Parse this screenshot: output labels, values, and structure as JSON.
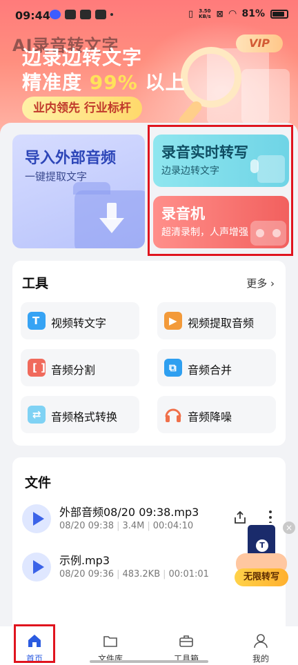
{
  "status_bar": {
    "time": "09:44",
    "net_speed_value": "3.50",
    "net_speed_unit": "KB/s",
    "battery": "81%"
  },
  "header": {
    "app_title": "AI录音转文字",
    "slogan_line1": "边录边转文字",
    "slogan_line2_prefix": "精准度",
    "slogan_line2_highlight": "99%",
    "slogan_line2_suffix": "以上",
    "badge": "业内领先 行业标杆",
    "vip_label": "VIP"
  },
  "feature_cards": {
    "import": {
      "title": "导入外部音频",
      "subtitle": "一键提取文字"
    },
    "realtime": {
      "title": "录音实时转写",
      "subtitle": "边录边转文字"
    },
    "recorder": {
      "title": "录音机",
      "subtitle": "超清录制，人声增强"
    }
  },
  "tools": {
    "title": "工具",
    "more_label": "更多",
    "items": [
      {
        "label": "视频转文字",
        "icon": "video-to-text-icon"
      },
      {
        "label": "视频提取音频",
        "icon": "video-extract-audio-icon"
      },
      {
        "label": "音频分割",
        "icon": "audio-split-icon"
      },
      {
        "label": "音频合并",
        "icon": "audio-merge-icon"
      },
      {
        "label": "音频格式转换",
        "icon": "audio-format-convert-icon"
      },
      {
        "label": "音频降噪",
        "icon": "headphones-icon"
      }
    ]
  },
  "files": {
    "title": "文件",
    "items": [
      {
        "name": "外部音频08/20 09:38.mp3",
        "date": "08/20 09:38",
        "size": "3.4M",
        "duration": "00:04:10"
      },
      {
        "name": "示例.mp3",
        "date": "08/20 09:36",
        "size": "483.2KB",
        "duration": "00:01:01"
      }
    ]
  },
  "promo": {
    "label": "无限转写",
    "logo_letter": "T",
    "close": "×"
  },
  "bottom_nav": {
    "items": [
      {
        "label": "首页",
        "icon": "home-icon",
        "active": true
      },
      {
        "label": "文件库",
        "icon": "folder-icon",
        "active": false
      },
      {
        "label": "工具箱",
        "icon": "toolbox-icon",
        "active": false
      },
      {
        "label": "我的",
        "icon": "person-icon",
        "active": false
      }
    ]
  },
  "colors": {
    "accent_blue": "#2b5be0",
    "banner_red": "#ff7b7b",
    "highlight_red": "#e0141e"
  }
}
